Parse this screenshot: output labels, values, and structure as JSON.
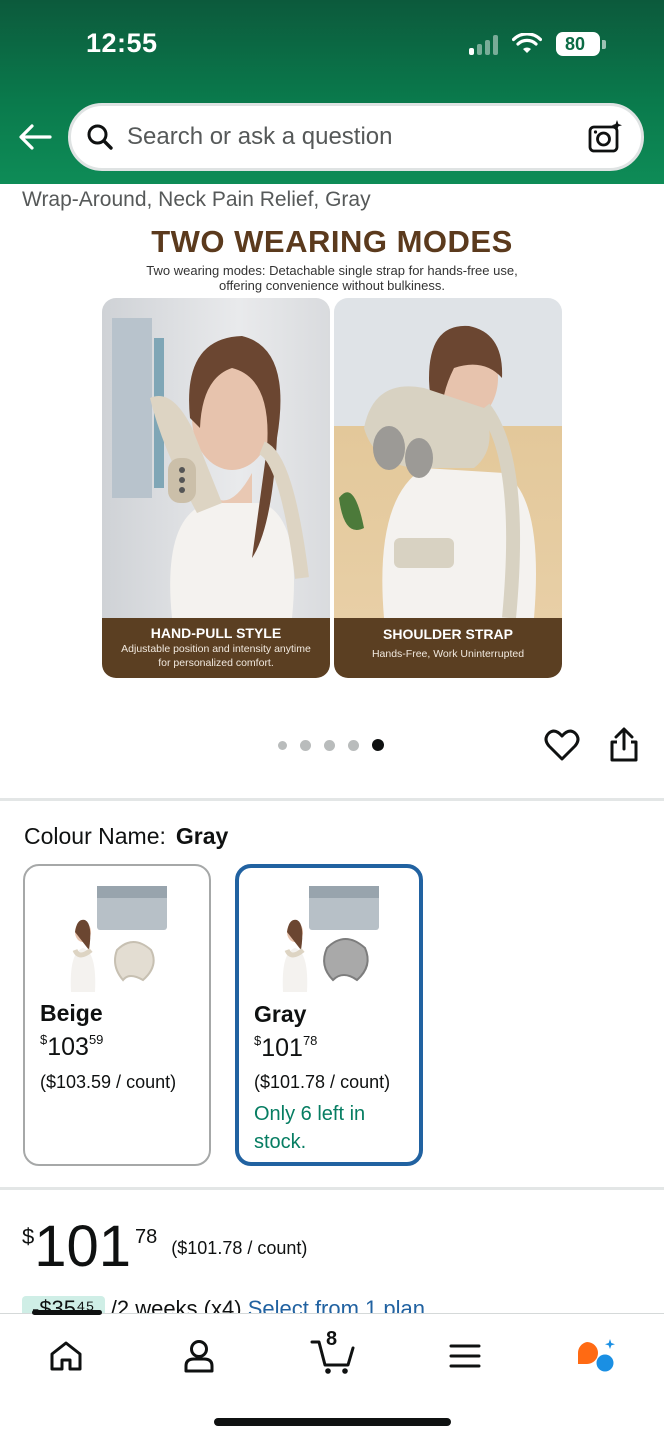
{
  "status_bar": {
    "time": "12:55",
    "battery": "80"
  },
  "search": {
    "placeholder": "Search or ask a question"
  },
  "product": {
    "title_fragment": "Wrap-Around, Neck Pain Relief, Gray",
    "image": {
      "heading": "TWO WEARING MODES",
      "subheading_line1": "Two wearing modes: Detachable single strap for hands-free use,",
      "subheading_line2": "offering convenience without bulkiness.",
      "panels": [
        {
          "title": "HAND-PULL STYLE",
          "line1": "Adjustable position and intensity anytime",
          "line2": "for personalized comfort."
        },
        {
          "title": "SHOULDER STRAP",
          "line1": "Hands-Free, Work Uninterrupted",
          "line2": ""
        }
      ]
    },
    "gallery": {
      "total": 5,
      "active_index": 5
    }
  },
  "colour": {
    "label": "Colour Name:",
    "selected": "Gray",
    "options": [
      {
        "name": "Beige",
        "symbol": "$",
        "whole": "103",
        "fraction": "59",
        "unit_price": "($103.59 / count)",
        "stock": "",
        "selected": false
      },
      {
        "name": "Gray",
        "symbol": "$",
        "whole": "101",
        "fraction": "78",
        "unit_price": "($101.78 / count)",
        "stock": "Only 6 left in stock.",
        "selected": true
      }
    ]
  },
  "price": {
    "symbol": "$",
    "whole": "101",
    "fraction": "78",
    "unit": "($101.78 / count)"
  },
  "partially_hidden": {
    "badge": "-$35⁴⁵",
    "middle": "/2 weeks (x4)",
    "link": "Select from 1 plan"
  },
  "bottom_nav": {
    "items": [
      "home-icon",
      "account-icon",
      "cart-icon",
      "menu-icon",
      "ai-assistant-icon"
    ],
    "cart_count": "8"
  },
  "colors": {
    "header_green": "#0a7a4c",
    "selected_border": "#2162a1",
    "stock_green": "#067d62",
    "link_blue": "#2162a1",
    "image_brown": "#5b3f22"
  }
}
